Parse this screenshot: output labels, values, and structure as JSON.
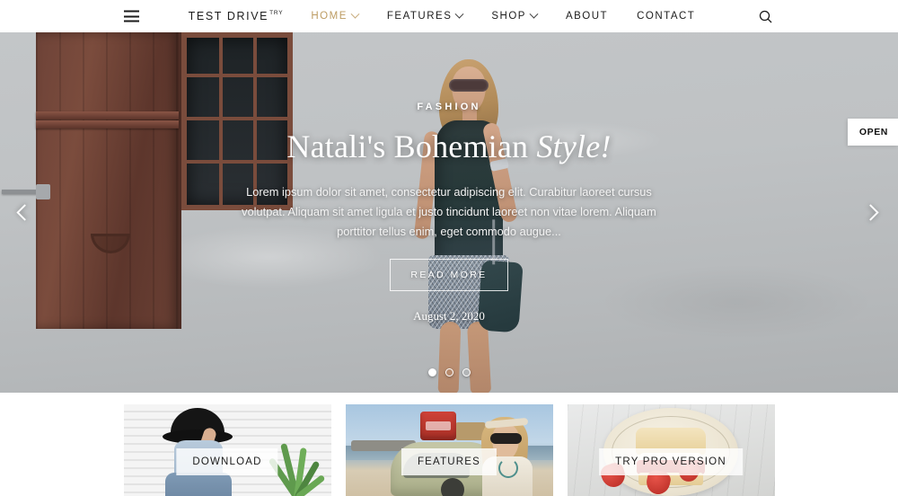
{
  "header": {
    "menu_icon": "hamburger-icon",
    "brand": {
      "name": "TEST DRIVE",
      "sup": "TRY"
    },
    "nav": [
      {
        "label": "HOME",
        "has_caret": true,
        "active": true
      },
      {
        "label": "FEATURES",
        "has_caret": true,
        "active": false
      },
      {
        "label": "SHOP",
        "has_caret": true,
        "active": false
      },
      {
        "label": "ABOUT",
        "has_caret": false,
        "active": false
      },
      {
        "label": "CONTACT",
        "has_caret": false,
        "active": false
      }
    ],
    "search_icon": "search-icon",
    "accent_color": "#bd9c63"
  },
  "hero": {
    "category": "FASHION",
    "title_main": "Natali's Bohemian ",
    "title_italic": "Style!",
    "description": "Lorem ipsum dolor sit amet, consectetur adipiscing elit. Curabitur laoreet cursus volutpat. Aliquam sit amet ligula et justo tincidunt laoreet non vitae lorem. Aliquam porttitor tellus enim, eget commodo augue...",
    "read_more": "READ MORE",
    "date": "August 2, 2020",
    "prev_arrow": "chevron-left-icon",
    "next_arrow": "chevron-right-icon",
    "dots": [
      {
        "active": true
      },
      {
        "active": false
      },
      {
        "active": false
      }
    ]
  },
  "side_tab": {
    "label": "OPEN"
  },
  "cards": [
    {
      "label": "DOWNLOAD"
    },
    {
      "label": "FEATURES"
    },
    {
      "label": "TRY PRO VERSION"
    }
  ]
}
